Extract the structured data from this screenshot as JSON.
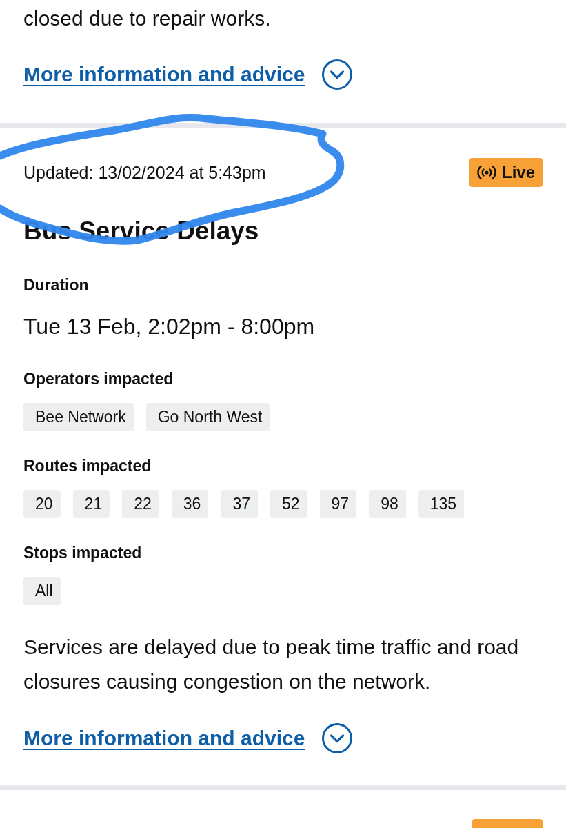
{
  "previous_card": {
    "description_end": "closed due to repair works.",
    "link": {
      "label": "More information and advice",
      "expanded": false
    }
  },
  "card": {
    "updated": {
      "text": "Updated: 13/02/2024 at 5:43pm",
      "circled": true
    },
    "badge": {
      "kind": "live",
      "label": "Live"
    },
    "title": "Bus Service Delays",
    "sections": [
      {
        "kind": "duration",
        "heading": "Duration",
        "value": "Tue 13 Feb, 2:02pm - 8:00pm"
      },
      {
        "kind": "operators",
        "heading": "Operators impacted",
        "tags": [
          "Bee Network",
          "Go North West"
        ]
      },
      {
        "kind": "routes",
        "heading": "Routes impacted",
        "tags": [
          "20",
          "21",
          "22",
          "36",
          "37",
          "52",
          "97",
          "98",
          "135"
        ]
      },
      {
        "kind": "stops",
        "heading": "Stops impacted",
        "tags": [
          "All"
        ]
      }
    ],
    "description": "Services are delayed due to peak time traffic and road closures causing congestion on the network.",
    "link": {
      "label": "More information and advice",
      "expanded": false
    }
  },
  "next_card": {
    "badge": {
      "kind": "live"
    }
  }
}
